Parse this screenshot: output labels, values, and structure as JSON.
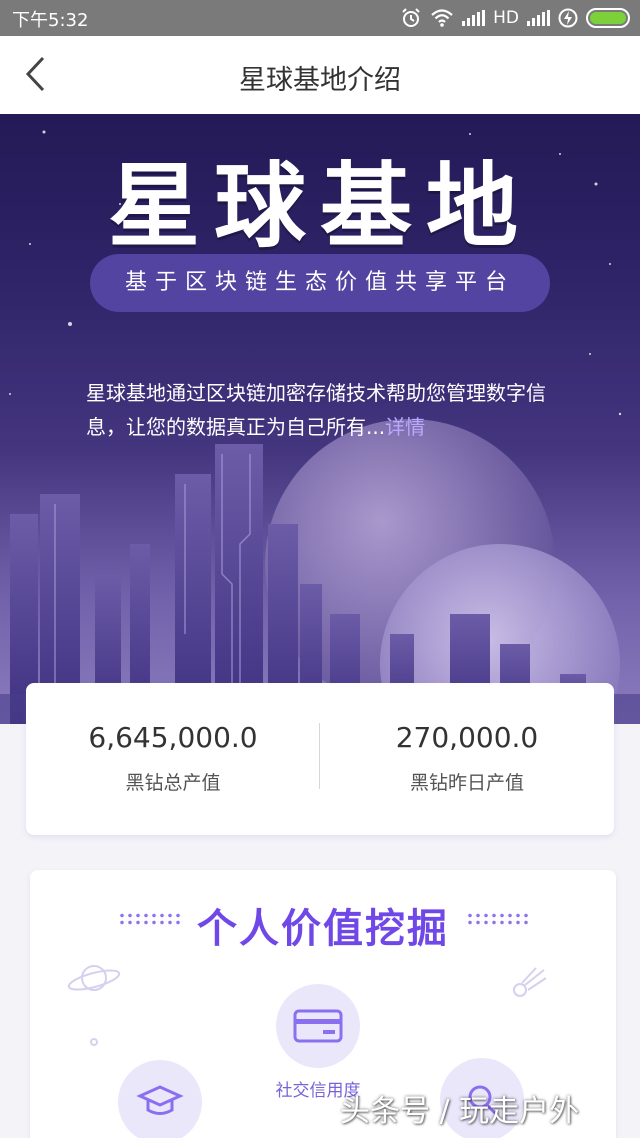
{
  "status_bar": {
    "time": "下午5:32",
    "network": "HD",
    "icons": [
      "alarm-icon",
      "wifi-icon",
      "signal-icon",
      "signal-icon",
      "charging-icon",
      "battery-icon"
    ],
    "battery_color": "#7cd13a"
  },
  "nav": {
    "title": "星球基地介绍",
    "back_icon": "chevron-left-icon"
  },
  "hero": {
    "title": "星球基地",
    "subtitle": "基于区块链生态价值共享平台",
    "description": "星球基地通过区块链加密存储技术帮助您管理数字信息，让您的数据真正为自己所有...",
    "detail_link": "详情"
  },
  "stats": [
    {
      "value": "6,645,000.0",
      "label": "黑钻总产值"
    },
    {
      "value": "270,000.0",
      "label": "黑钻昨日产值"
    }
  ],
  "value_section": {
    "title": "个人价值挖掘",
    "items": [
      {
        "label": "社交信用度",
        "icon": "card-icon"
      },
      {
        "label": "",
        "icon": "graduation-cap-icon"
      },
      {
        "label": "",
        "icon": "search-icon"
      }
    ],
    "accent": "#7048e8"
  },
  "watermark": "头条号 / 玩走户外"
}
